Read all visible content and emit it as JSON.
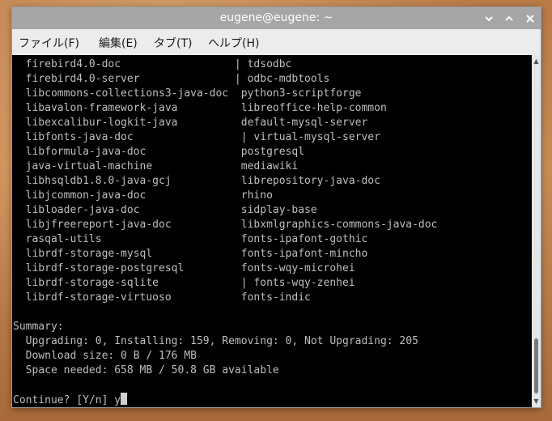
{
  "window": {
    "title": "eugene@eugene: ~",
    "buttons": {
      "minimize": "⌄",
      "maximize": "⌃",
      "close": "✕"
    }
  },
  "menubar": {
    "items": [
      "ファイル(F)",
      "編集(E)",
      "タブ(T)",
      "ヘルプ(H)"
    ]
  },
  "terminal": {
    "lines": [
      "  firebird4.0-doc                  | tdsodbc",
      "  firebird4.0-server               | odbc-mdbtools",
      "  libcommons-collections3-java-doc  python3-scriptforge",
      "  libavalon-framework-java          libreoffice-help-common",
      "  libexcalibur-logkit-java          default-mysql-server",
      "  libfonts-java-doc                 | virtual-mysql-server",
      "  libformula-java-doc               postgresql",
      "  java-virtual-machine              mediawiki",
      "  libhsqldb1.8.0-java-gcj           librepository-java-doc",
      "  libjcommon-java-doc               rhino",
      "  libloader-java-doc                sidplay-base",
      "  libjfreereport-java-doc           libxmlgraphics-commons-java-doc",
      "  rasqal-utils                      fonts-ipafont-gothic",
      "  librdf-storage-mysql              fonts-ipafont-mincho",
      "  librdf-storage-postgresql         fonts-wqy-microhei",
      "  librdf-storage-sqlite             | fonts-wqy-zenhei",
      "  librdf-storage-virtuoso           fonts-indic",
      "",
      "Summary:",
      "  Upgrading: 0, Installing: 159, Removing: 0, Not Upgrading: 205",
      "  Download size: 0 B / 176 MB",
      "  Space needed: 658 MB / 50.8 GB available",
      ""
    ],
    "prompt": "Continue? [Y/n] y"
  },
  "scrollbar": {
    "up_icon": "▲",
    "down_icon": "▼"
  }
}
